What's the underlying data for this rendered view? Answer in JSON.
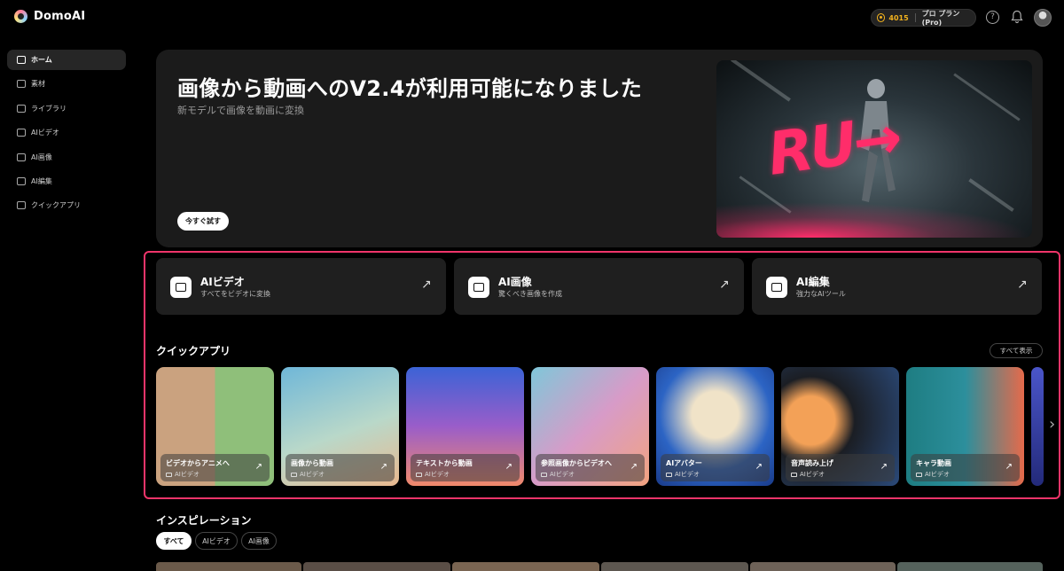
{
  "app": {
    "name": "DomoAI"
  },
  "header": {
    "credits": "4015",
    "plan": "プロ プラン(Pro)"
  },
  "sidebar": {
    "items": [
      {
        "label": "ホーム",
        "icon": "home-icon",
        "active": true
      },
      {
        "label": "素材",
        "icon": "asset-icon",
        "active": false
      },
      {
        "label": "ライブラリ",
        "icon": "library-icon",
        "active": false
      },
      {
        "label": "AIビデオ",
        "icon": "video-icon",
        "active": false
      },
      {
        "label": "AI画像",
        "icon": "image-icon",
        "active": false
      },
      {
        "label": "AI編集",
        "icon": "edit-icon",
        "active": false
      },
      {
        "label": "クイックアプリ",
        "icon": "quick-app-icon",
        "active": false
      }
    ]
  },
  "hero": {
    "title": "画像から動画へのV2.4が利用可能になりました",
    "subtitle": "新モデルで画像を動画に変換",
    "button": "今すぐ試す"
  },
  "features": [
    {
      "title": "AIビデオ",
      "desc": "すべてをビデオに変換"
    },
    {
      "title": "AI画像",
      "desc": "驚くべき画像を作成"
    },
    {
      "title": "AI編集",
      "desc": "強力なAIツール"
    }
  ],
  "quick_apps": {
    "title": "クイックアプリ",
    "show_all": "すべて表示",
    "items": [
      {
        "name": "ビデオからアニメへ",
        "category": "AIビデオ"
      },
      {
        "name": "画像から動画",
        "category": "AIビデオ"
      },
      {
        "name": "テキストから動画",
        "category": "AIビデオ"
      },
      {
        "name": "参照画像からビデオへ",
        "category": "AIビデオ"
      },
      {
        "name": "AIアバター",
        "category": "AIビデオ"
      },
      {
        "name": "音声読み上げ",
        "category": "AIビデオ"
      },
      {
        "name": "キャラ動画",
        "category": "AIビデオ"
      }
    ]
  },
  "inspiration": {
    "title": "インスピレーション",
    "chips": [
      "すべて",
      "AIビデオ",
      "AI画像"
    ]
  },
  "colors": {
    "accent_highlight": "#f0346a",
    "credit_gold": "#f2b21d",
    "card_bg": "#1f1f1f"
  }
}
